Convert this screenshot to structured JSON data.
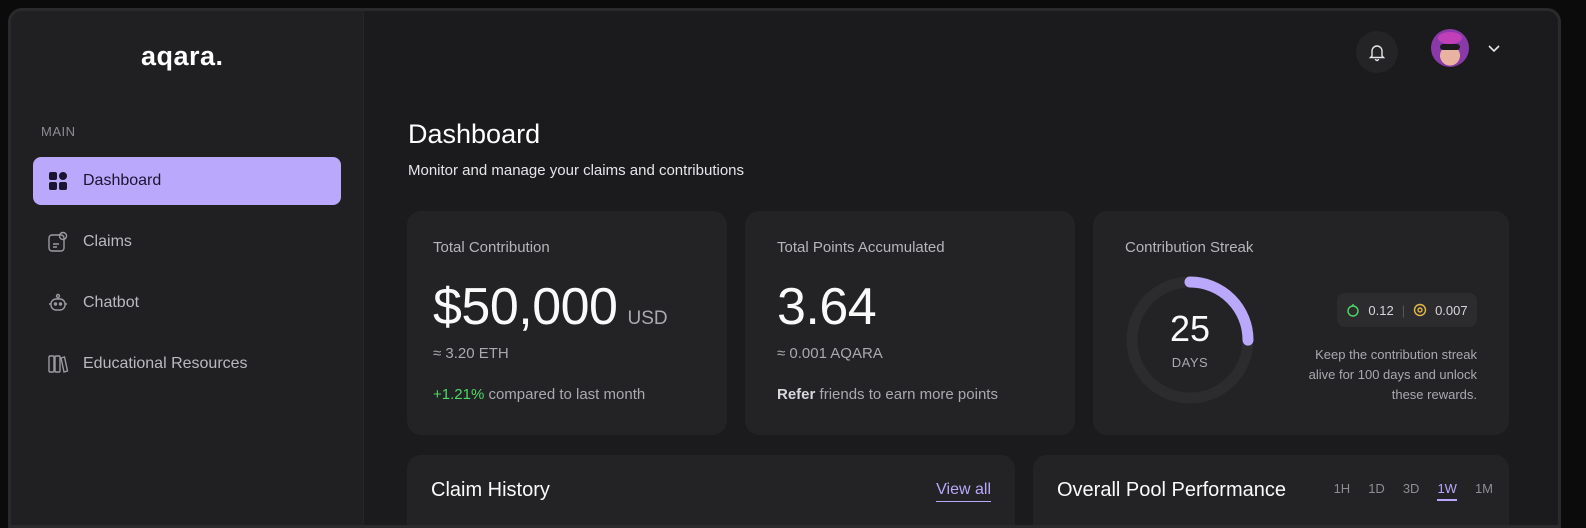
{
  "app": {
    "logo": "aqara."
  },
  "sidebar": {
    "section_label": "MAIN",
    "items": [
      {
        "label": "Dashboard",
        "icon": "dashboard-grid-icon",
        "active": true
      },
      {
        "label": "Claims",
        "icon": "claims-icon",
        "active": false
      },
      {
        "label": "Chatbot",
        "icon": "chatbot-icon",
        "active": false
      },
      {
        "label": "Educational Resources",
        "icon": "books-icon",
        "active": false
      }
    ]
  },
  "header": {
    "icons": [
      "bell-icon",
      "avatar",
      "chevron-down-icon"
    ]
  },
  "page": {
    "title": "Dashboard",
    "subtitle": "Monitor and manage your claims and contributions"
  },
  "cards": {
    "contribution": {
      "title": "Total Contribution",
      "value": "$50,000",
      "unit": "USD",
      "eth": "≈ 3.20 ETH",
      "change": "+1.21%",
      "change_text": " compared to last month"
    },
    "points": {
      "title": "Total Points Accumulated",
      "value": "3.64",
      "aqara": "≈ 0.001 AQARA",
      "refer_bold": "Refer",
      "refer_text": " friends to earn more points"
    },
    "streak": {
      "title": "Contribution Streak",
      "days": "25",
      "days_label": "DAYS",
      "progress_fraction": 0.25,
      "reward_a": "0.12",
      "reward_b": "0.007",
      "note": "Keep the contribution streak alive for 100 days and unlock these rewards."
    }
  },
  "claim_history": {
    "title": "Claim History",
    "view_all": "View all"
  },
  "pool": {
    "title": "Overall Pool Performance",
    "ranges": [
      "1H",
      "1D",
      "3D",
      "1W",
      "1M"
    ],
    "selected": "1W"
  },
  "colors": {
    "accent": "#b9a8fb",
    "positive": "#4cd964",
    "reward_a": "#4cd964",
    "reward_b": "#e5b84a"
  }
}
